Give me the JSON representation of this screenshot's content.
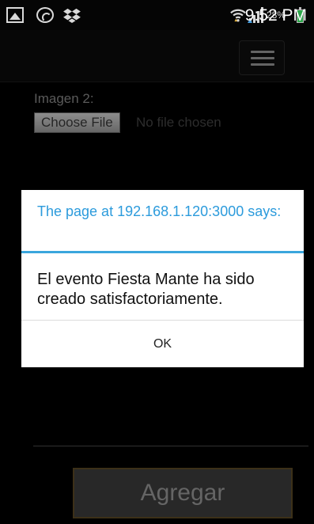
{
  "status_bar": {
    "icons_left": [
      "gallery-icon",
      "whatsapp-icon",
      "dropbox-icon"
    ],
    "wifi_icon": "wifi-icon",
    "signal_icon": "signal-icon",
    "battery_percent": "28%",
    "battery_color": "#2ea84c",
    "time": "9:52 PM"
  },
  "header": {
    "menu_icon": "hamburger-menu-icon"
  },
  "form": {
    "image2_label": "Imagen 2:",
    "choose_file_label": "Choose File",
    "file_status": "No file chosen",
    "submit_label": "Agregar"
  },
  "dialog": {
    "title": "The page at 192.168.1.120:3000 says:",
    "message": "El evento Fiesta Mante ha sido creado satisfactoriamente.",
    "ok_label": "OK",
    "accent_color": "#2c9bdc"
  }
}
